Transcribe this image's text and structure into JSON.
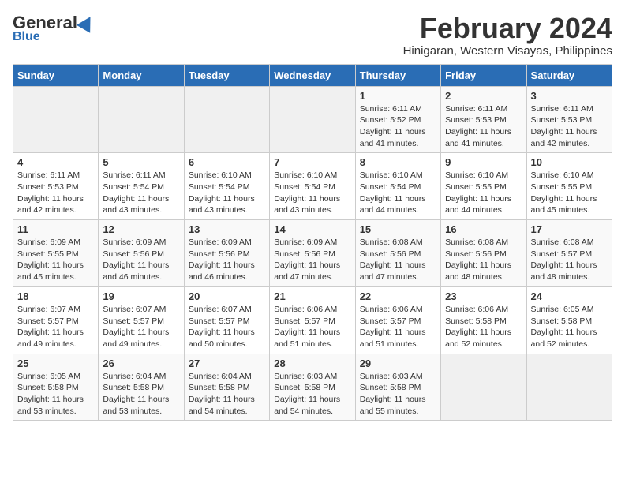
{
  "logo": {
    "general": "General",
    "blue": "Blue"
  },
  "title": "February 2024",
  "subtitle": "Hinigaran, Western Visayas, Philippines",
  "days_of_week": [
    "Sunday",
    "Monday",
    "Tuesday",
    "Wednesday",
    "Thursday",
    "Friday",
    "Saturday"
  ],
  "weeks": [
    [
      {
        "day": "",
        "empty": true
      },
      {
        "day": "",
        "empty": true
      },
      {
        "day": "",
        "empty": true
      },
      {
        "day": "",
        "empty": true
      },
      {
        "day": "1",
        "sunrise": "6:11 AM",
        "sunset": "5:52 PM",
        "daylight": "11 hours and 41 minutes."
      },
      {
        "day": "2",
        "sunrise": "6:11 AM",
        "sunset": "5:53 PM",
        "daylight": "11 hours and 41 minutes."
      },
      {
        "day": "3",
        "sunrise": "6:11 AM",
        "sunset": "5:53 PM",
        "daylight": "11 hours and 42 minutes."
      }
    ],
    [
      {
        "day": "4",
        "sunrise": "6:11 AM",
        "sunset": "5:53 PM",
        "daylight": "11 hours and 42 minutes."
      },
      {
        "day": "5",
        "sunrise": "6:11 AM",
        "sunset": "5:54 PM",
        "daylight": "11 hours and 43 minutes."
      },
      {
        "day": "6",
        "sunrise": "6:10 AM",
        "sunset": "5:54 PM",
        "daylight": "11 hours and 43 minutes."
      },
      {
        "day": "7",
        "sunrise": "6:10 AM",
        "sunset": "5:54 PM",
        "daylight": "11 hours and 43 minutes."
      },
      {
        "day": "8",
        "sunrise": "6:10 AM",
        "sunset": "5:54 PM",
        "daylight": "11 hours and 44 minutes."
      },
      {
        "day": "9",
        "sunrise": "6:10 AM",
        "sunset": "5:55 PM",
        "daylight": "11 hours and 44 minutes."
      },
      {
        "day": "10",
        "sunrise": "6:10 AM",
        "sunset": "5:55 PM",
        "daylight": "11 hours and 45 minutes."
      }
    ],
    [
      {
        "day": "11",
        "sunrise": "6:09 AM",
        "sunset": "5:55 PM",
        "daylight": "11 hours and 45 minutes."
      },
      {
        "day": "12",
        "sunrise": "6:09 AM",
        "sunset": "5:56 PM",
        "daylight": "11 hours and 46 minutes."
      },
      {
        "day": "13",
        "sunrise": "6:09 AM",
        "sunset": "5:56 PM",
        "daylight": "11 hours and 46 minutes."
      },
      {
        "day": "14",
        "sunrise": "6:09 AM",
        "sunset": "5:56 PM",
        "daylight": "11 hours and 47 minutes."
      },
      {
        "day": "15",
        "sunrise": "6:08 AM",
        "sunset": "5:56 PM",
        "daylight": "11 hours and 47 minutes."
      },
      {
        "day": "16",
        "sunrise": "6:08 AM",
        "sunset": "5:56 PM",
        "daylight": "11 hours and 48 minutes."
      },
      {
        "day": "17",
        "sunrise": "6:08 AM",
        "sunset": "5:57 PM",
        "daylight": "11 hours and 48 minutes."
      }
    ],
    [
      {
        "day": "18",
        "sunrise": "6:07 AM",
        "sunset": "5:57 PM",
        "daylight": "11 hours and 49 minutes."
      },
      {
        "day": "19",
        "sunrise": "6:07 AM",
        "sunset": "5:57 PM",
        "daylight": "11 hours and 49 minutes."
      },
      {
        "day": "20",
        "sunrise": "6:07 AM",
        "sunset": "5:57 PM",
        "daylight": "11 hours and 50 minutes."
      },
      {
        "day": "21",
        "sunrise": "6:06 AM",
        "sunset": "5:57 PM",
        "daylight": "11 hours and 51 minutes."
      },
      {
        "day": "22",
        "sunrise": "6:06 AM",
        "sunset": "5:57 PM",
        "daylight": "11 hours and 51 minutes."
      },
      {
        "day": "23",
        "sunrise": "6:06 AM",
        "sunset": "5:58 PM",
        "daylight": "11 hours and 52 minutes."
      },
      {
        "day": "24",
        "sunrise": "6:05 AM",
        "sunset": "5:58 PM",
        "daylight": "11 hours and 52 minutes."
      }
    ],
    [
      {
        "day": "25",
        "sunrise": "6:05 AM",
        "sunset": "5:58 PM",
        "daylight": "11 hours and 53 minutes."
      },
      {
        "day": "26",
        "sunrise": "6:04 AM",
        "sunset": "5:58 PM",
        "daylight": "11 hours and 53 minutes."
      },
      {
        "day": "27",
        "sunrise": "6:04 AM",
        "sunset": "5:58 PM",
        "daylight": "11 hours and 54 minutes."
      },
      {
        "day": "28",
        "sunrise": "6:03 AM",
        "sunset": "5:58 PM",
        "daylight": "11 hours and 54 minutes."
      },
      {
        "day": "29",
        "sunrise": "6:03 AM",
        "sunset": "5:58 PM",
        "daylight": "11 hours and 55 minutes."
      },
      {
        "day": "",
        "empty": true
      },
      {
        "day": "",
        "empty": true
      }
    ]
  ],
  "labels": {
    "sunrise": "Sunrise:",
    "sunset": "Sunset:",
    "daylight": "Daylight:"
  }
}
